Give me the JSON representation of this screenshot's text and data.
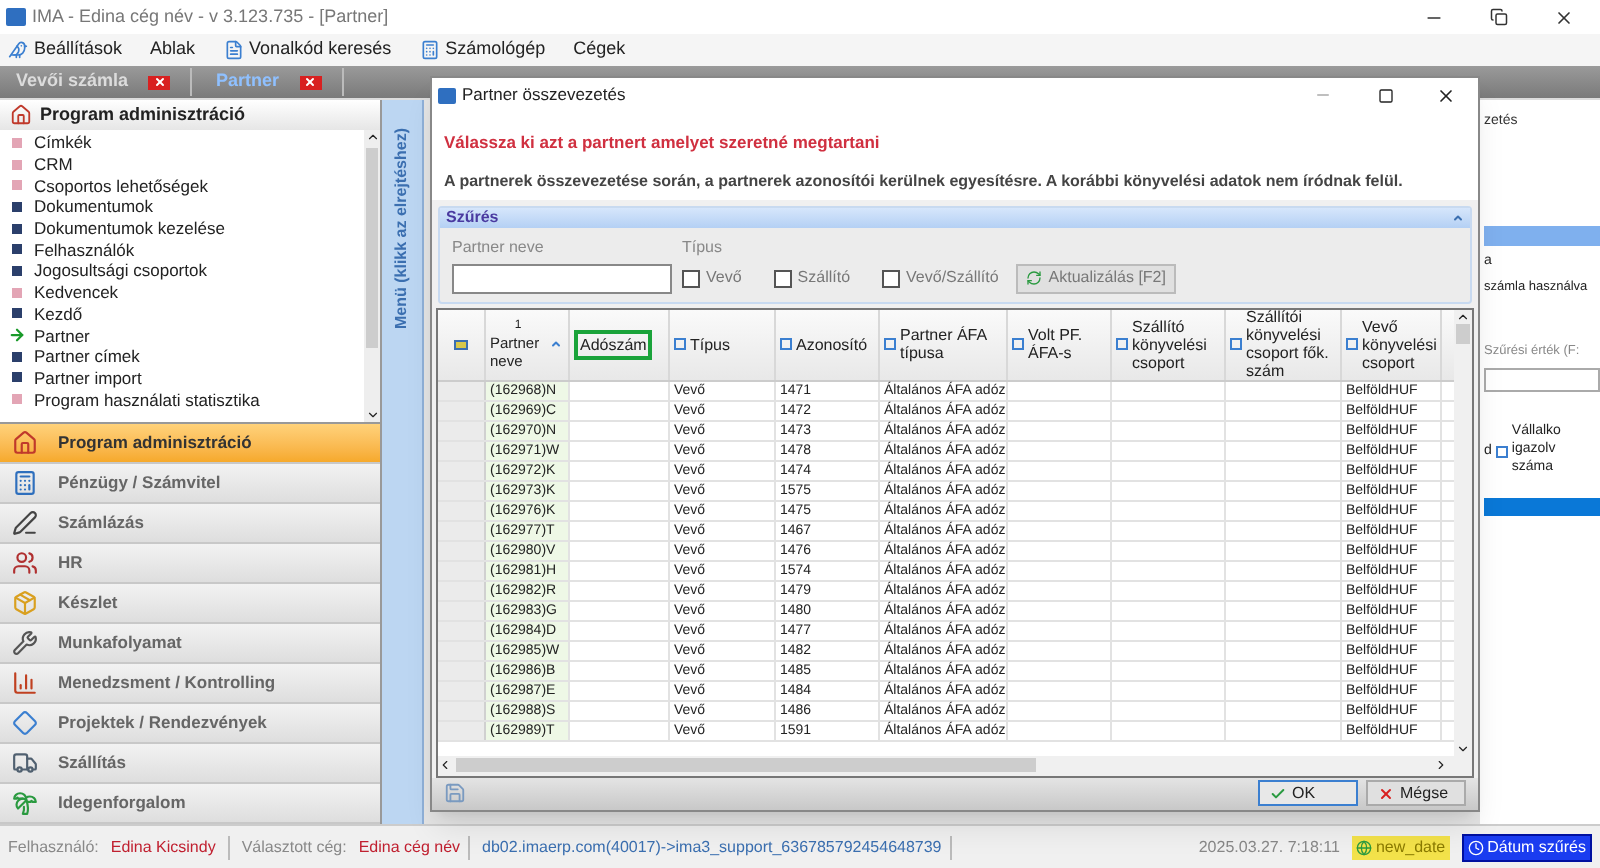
{
  "window": {
    "title": "IMA - Edina cég név - v 3.123.735 - [Partner]"
  },
  "menu": [
    "Beállítások",
    "Ablak",
    "Vonalkód keresés",
    "Számológép",
    "Cégek"
  ],
  "doc_tabs": [
    {
      "label": "Vevői számla",
      "selected": false
    },
    {
      "label": "Partner",
      "selected": true
    }
  ],
  "sidebar": {
    "header": "Program adminisztráció",
    "strip": "Menü (klikk az elrejtéshez)",
    "items": [
      {
        "label": "Címkék",
        "kind": "light"
      },
      {
        "label": "CRM",
        "kind": "light"
      },
      {
        "label": "Csoportos lehetőségek",
        "kind": "light"
      },
      {
        "label": "Dokumentumok",
        "kind": "dark"
      },
      {
        "label": "Dokumentumok kezelése",
        "kind": "dark"
      },
      {
        "label": "Felhasználók",
        "kind": "dark"
      },
      {
        "label": "Jogosultsági csoportok",
        "kind": "dark"
      },
      {
        "label": "Kedvencek",
        "kind": "light"
      },
      {
        "label": "Kezdő",
        "kind": "dark"
      },
      {
        "label": "Partner",
        "kind": "arrow"
      },
      {
        "label": "Partner címek",
        "kind": "dark"
      },
      {
        "label": "Partner import",
        "kind": "dark"
      },
      {
        "label": "Program használati statisztika",
        "kind": "light"
      }
    ]
  },
  "modules": [
    {
      "label": "Program adminisztráció",
      "selected": true
    },
    {
      "label": "Pénzügy / Számvitel",
      "selected": false
    },
    {
      "label": "Számlázás",
      "selected": false
    },
    {
      "label": "HR",
      "selected": false
    },
    {
      "label": "Készlet",
      "selected": false
    },
    {
      "label": "Munkafolyamat",
      "selected": false
    },
    {
      "label": "Menedzsment / Kontrolling",
      "selected": false
    },
    {
      "label": "Projektek / Rendezvények",
      "selected": false
    },
    {
      "label": "Szállítás",
      "selected": false
    },
    {
      "label": "Idegenforgalom",
      "selected": false
    }
  ],
  "background": {
    "title_part": "zetés",
    "label_part": "a",
    "checkbox_label": "számla használva",
    "filter_label": "Szűrési érték (F:",
    "column_part": "d",
    "column_header": "Vállalko igazolv száma"
  },
  "dialog": {
    "title": "Partner összevezetés",
    "warning": "Válassza ki azt a partnert amelyet szeretné megtartani",
    "info": "A partnerek összevezetése során, a partnerek azonosítói kerülnek egyesítésre. A korábbi könyvelési adatok nem íródnak felül.",
    "filter": {
      "title": "Szűrés",
      "name_label": "Partner neve",
      "type_label": "Típus",
      "type_options": [
        {
          "label": "Vevő",
          "checked": false
        },
        {
          "label": "Szállító",
          "checked": false
        },
        {
          "label": "Vevő/Szállító",
          "checked": false
        }
      ],
      "refresh_button": "Aktualizálás [F2]"
    },
    "table": {
      "sort_index": "1",
      "columns": [
        {
          "label": "Partner neve",
          "kind": "sort",
          "highlighted": false
        },
        {
          "label": "Adószám",
          "kind": "plain",
          "highlighted": true
        },
        {
          "label": "Típus",
          "kind": "filter",
          "highlighted": false
        },
        {
          "label": "Azonosító",
          "kind": "filter",
          "highlighted": false
        },
        {
          "label": "Partner ÁFA típusa",
          "kind": "filter",
          "highlighted": false
        },
        {
          "label": "Volt PF. ÁFA-s",
          "kind": "filter",
          "highlighted": false
        },
        {
          "label": "Szállító könyvelési csoport",
          "kind": "filter",
          "highlighted": false
        },
        {
          "label": "Szállítói könyvelési csoport fők. szám",
          "kind": "filter",
          "highlighted": false
        },
        {
          "label": "Vevő könyvelési csoport",
          "kind": "filter",
          "highlighted": false
        }
      ],
      "rows": [
        {
          "partner_name": "(162968)N",
          "type": "Vevő",
          "id": "1471",
          "vat_type": "Általános ÁFA adóz",
          "customer_group": "BelföldHUF"
        },
        {
          "partner_name": "(162969)C",
          "type": "Vevő",
          "id": "1472",
          "vat_type": "Általános ÁFA adóz",
          "customer_group": "BelföldHUF"
        },
        {
          "partner_name": "(162970)N",
          "type": "Vevő",
          "id": "1473",
          "vat_type": "Általános ÁFA adóz",
          "customer_group": "BelföldHUF"
        },
        {
          "partner_name": "(162971)W",
          "type": "Vevő",
          "id": "1478",
          "vat_type": "Általános ÁFA adóz",
          "customer_group": "BelföldHUF"
        },
        {
          "partner_name": "(162972)K",
          "type": "Vevő",
          "id": "1474",
          "vat_type": "Általános ÁFA adóz",
          "customer_group": "BelföldHUF"
        },
        {
          "partner_name": "(162973)K",
          "type": "Vevő",
          "id": "1575",
          "vat_type": "Általános ÁFA adóz",
          "customer_group": "BelföldHUF"
        },
        {
          "partner_name": "(162976)K",
          "type": "Vevő",
          "id": "1475",
          "vat_type": "Általános ÁFA adóz",
          "customer_group": "BelföldHUF"
        },
        {
          "partner_name": "(162977)T",
          "type": "Vevő",
          "id": "1467",
          "vat_type": "Általános ÁFA adóz",
          "customer_group": "BelföldHUF"
        },
        {
          "partner_name": "(162980)V",
          "type": "Vevő",
          "id": "1476",
          "vat_type": "Általános ÁFA adóz",
          "customer_group": "BelföldHUF"
        },
        {
          "partner_name": "(162981)H",
          "type": "Vevő",
          "id": "1574",
          "vat_type": "Általános ÁFA adóz",
          "customer_group": "BelföldHUF"
        },
        {
          "partner_name": "(162982)R",
          "type": "Vevő",
          "id": "1479",
          "vat_type": "Általános ÁFA adóz",
          "customer_group": "BelföldHUF"
        },
        {
          "partner_name": "(162983)G",
          "type": "Vevő",
          "id": "1480",
          "vat_type": "Általános ÁFA adóz",
          "customer_group": "BelföldHUF"
        },
        {
          "partner_name": "(162984)D",
          "type": "Vevő",
          "id": "1477",
          "vat_type": "Általános ÁFA adóz",
          "customer_group": "BelföldHUF"
        },
        {
          "partner_name": "(162985)W",
          "type": "Vevő",
          "id": "1482",
          "vat_type": "Általános ÁFA adóz",
          "customer_group": "BelföldHUF"
        },
        {
          "partner_name": "(162986)B",
          "type": "Vevő",
          "id": "1485",
          "vat_type": "Általános ÁFA adóz",
          "customer_group": "BelföldHUF"
        },
        {
          "partner_name": "(162987)E",
          "type": "Vevő",
          "id": "1484",
          "vat_type": "Általános ÁFA adóz",
          "customer_group": "BelföldHUF"
        },
        {
          "partner_name": "(162988)S",
          "type": "Vevő",
          "id": "1486",
          "vat_type": "Általános ÁFA adóz",
          "customer_group": "BelföldHUF"
        },
        {
          "partner_name": "(162989)T",
          "type": "Vevő",
          "id": "1591",
          "vat_type": "Általános ÁFA adóz",
          "customer_group": "BelföldHUF"
        }
      ]
    },
    "ok_button": "OK",
    "cancel_button": "Mégse"
  },
  "status_bar": {
    "user_label": "Felhasználó:",
    "user": "Edina Kicsindy",
    "company_label": "Választott cég:",
    "company": "Edina cég név",
    "connection": "db02.imaerp.com(40017)->ima3_support_636785792454648739",
    "datetime": "2025.03.27. 7:18:11",
    "new_date": "new_date",
    "date_filter": "Dátum szűrés"
  }
}
